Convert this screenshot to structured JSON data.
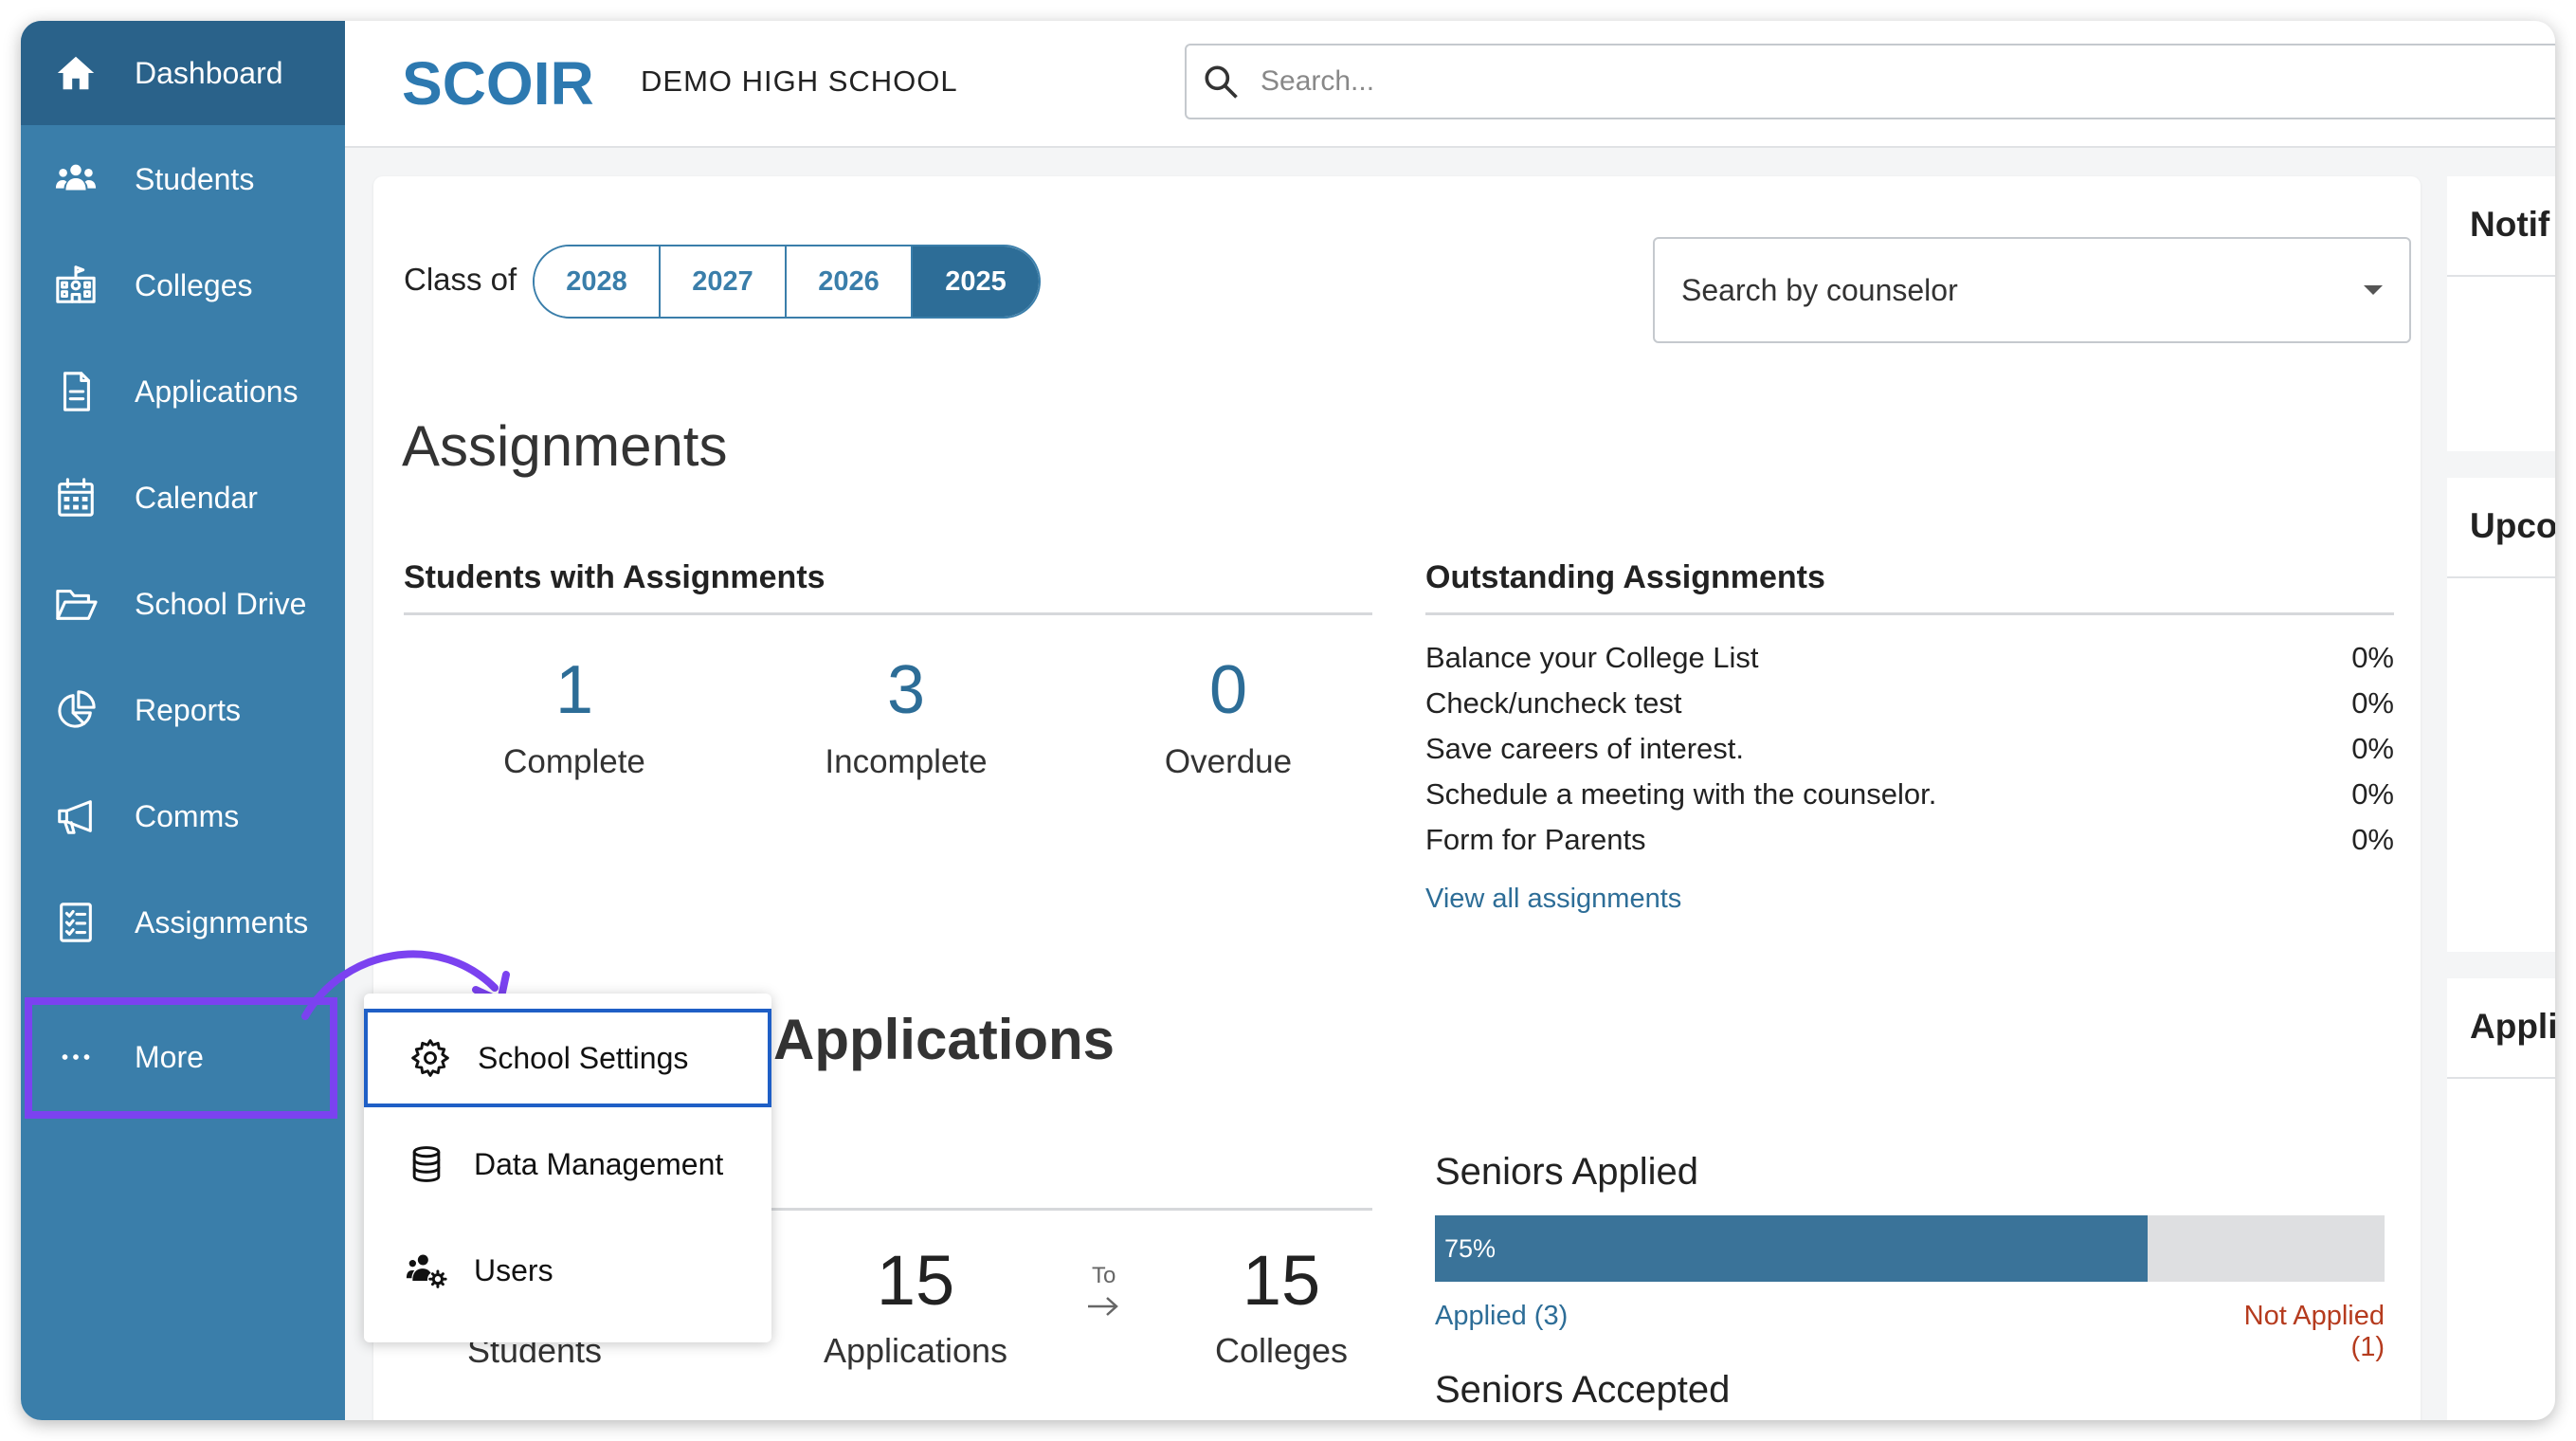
{
  "header": {
    "logo_text": "SCOIR",
    "school_name": "DEMO HIGH SCHOOL",
    "search_placeholder": "Search..."
  },
  "sidebar": {
    "items": [
      {
        "label": "Dashboard",
        "icon": "home-icon",
        "active": true
      },
      {
        "label": "Students",
        "icon": "users-icon"
      },
      {
        "label": "Colleges",
        "icon": "college-building-icon"
      },
      {
        "label": "Applications",
        "icon": "document-icon"
      },
      {
        "label": "Calendar",
        "icon": "calendar-icon"
      },
      {
        "label": "School Drive",
        "icon": "folder-open-icon"
      },
      {
        "label": "Reports",
        "icon": "pie-chart-icon"
      },
      {
        "label": "Comms",
        "icon": "megaphone-icon"
      },
      {
        "label": "Assignments",
        "icon": "checklist-icon"
      },
      {
        "label": "More",
        "icon": "ellipsis-icon"
      }
    ]
  },
  "filters": {
    "class_of_label": "Class of",
    "years": [
      "2028",
      "2027",
      "2026",
      "2025"
    ],
    "selected_year": "2025",
    "counselor_placeholder": "Search by counselor"
  },
  "assignments": {
    "title": "Assignments",
    "students_with": {
      "title": "Students with Assignments",
      "stats": [
        {
          "value": "1",
          "label": "Complete"
        },
        {
          "value": "3",
          "label": "Incomplete"
        },
        {
          "value": "0",
          "label": "Overdue"
        }
      ]
    },
    "outstanding": {
      "title": "Outstanding Assignments",
      "rows": [
        {
          "name": "Balance your College List",
          "pct": "0%"
        },
        {
          "name": "Check/uncheck test",
          "pct": "0%"
        },
        {
          "name": "Save careers of interest.",
          "pct": "0%"
        },
        {
          "name": "Schedule a meeting with the counselor.",
          "pct": "0%"
        },
        {
          "name": "Form for Parents",
          "pct": "0%"
        }
      ],
      "view_all": "View all assignments"
    }
  },
  "applications": {
    "title": "Applications",
    "students_label": "Students",
    "applications_count": "15",
    "applications_label": "Applications",
    "to_label": "To",
    "colleges_count": "15",
    "colleges_label": "Colleges",
    "seniors_applied": {
      "title": "Seniors Applied",
      "percent": 75,
      "percent_label": "75%",
      "applied": "Applied (3)",
      "not_applied": "Not Applied (1)"
    },
    "seniors_accepted_title": "Seniors Accepted"
  },
  "right_panel": {
    "cards": [
      "Notif",
      "Upco",
      "Appli"
    ]
  },
  "more_menu": {
    "items": [
      {
        "label": "School Settings",
        "icon": "gear-icon",
        "selected": true
      },
      {
        "label": "Data Management",
        "icon": "database-icon"
      },
      {
        "label": "Users",
        "icon": "users-gear-icon"
      }
    ]
  },
  "colors": {
    "sidebar": "#3a7eaa",
    "sidebar_active": "#2a628a",
    "accent": "#2d6d97",
    "highlight": "#7b42f0",
    "selected_border": "#1f5fc6",
    "not_applied": "#b53b1e"
  }
}
